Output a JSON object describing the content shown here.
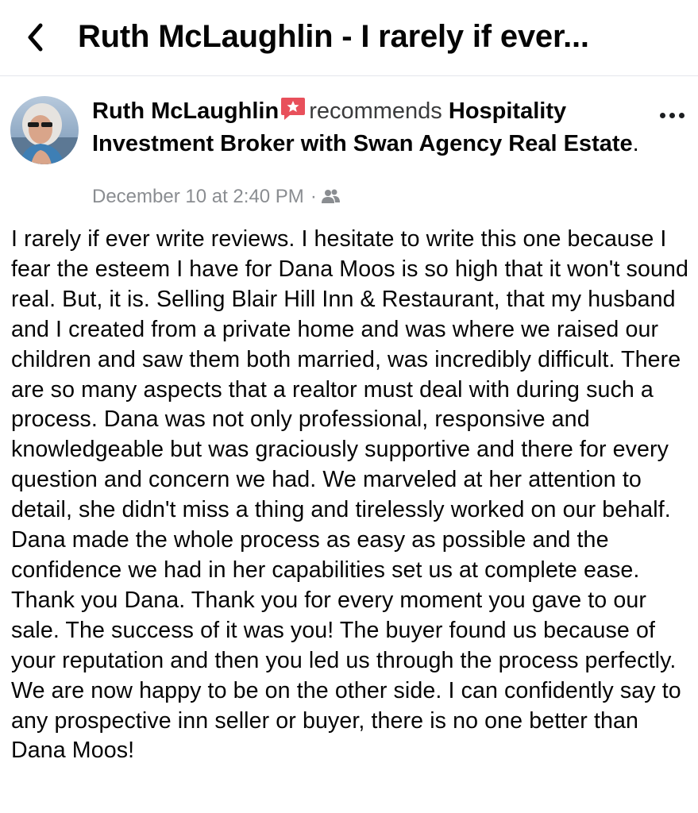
{
  "header": {
    "title": "Ruth McLaughlin - I rarely if ever..."
  },
  "post": {
    "author": "Ruth McLaughlin",
    "verb": "recommends",
    "page_name": "Hospitality Investment Broker with Swan Agency Real Estate",
    "period": ".",
    "timestamp": "December 10 at 2:40 PM",
    "separator": "·",
    "audience_icon": "friends-icon",
    "review_text": "I rarely if ever write reviews. I hesitate to write this one because I fear the esteem I have for Dana Moos is so high that it won't sound real. But, it is. Selling Blair Hill Inn & Restaurant, that my husband and I created from a private home and was where we raised our children and saw them both married, was incredibly difficult. There are so many aspects that a realtor must deal with during such a process. Dana was not only professional, responsive and knowledgeable but was graciously supportive and there for every question and concern we had. We marveled at her attention to detail, she didn't miss a thing and tirelessly worked on our behalf. Dana made the whole process as easy as possible and the confidence we had in her capabilities set us at complete ease. Thank you Dana. Thank you for every moment you gave to our sale. The success of it was you! The buyer found us because of your reputation and then you led us through the process perfectly. We are now happy to be on the other side. I can confidently say to any prospective inn seller or buyer, there is no one better than Dana Moos!"
  },
  "colors": {
    "badge": "#e8505b",
    "meta_text": "#8a8d91",
    "divider": "#e4e6eb"
  }
}
